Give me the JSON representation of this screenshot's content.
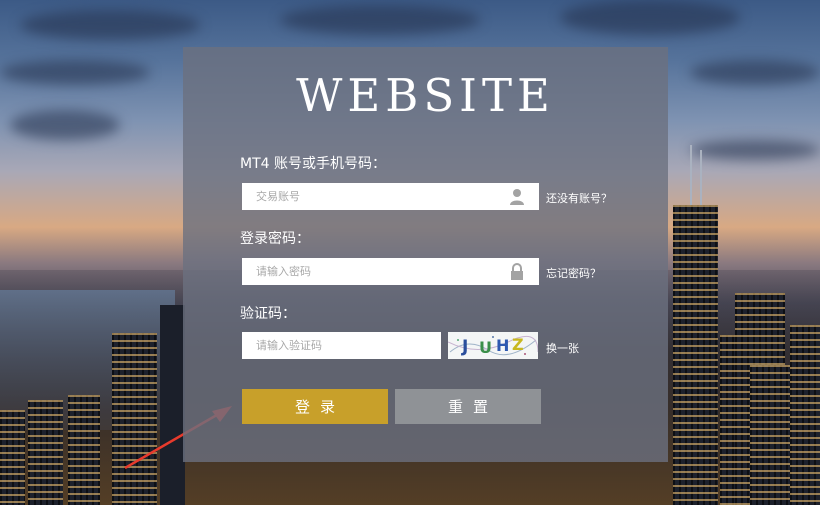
{
  "brand": {
    "title": "WEBSITE"
  },
  "account": {
    "label": "MT4 账号或手机号码：",
    "placeholder": "交易账号",
    "icon": "user-icon",
    "side_link": "还没有账号？"
  },
  "password": {
    "label": "登录密码：",
    "placeholder": "请输入密码",
    "icon": "lock-icon",
    "side_link": "忘记密码？"
  },
  "captcha": {
    "label": "验证码：",
    "placeholder": "请输入验证码",
    "image_text": "JUHZ",
    "refresh_link": "换一张"
  },
  "buttons": {
    "login": "登录",
    "reset": "重置",
    "login_color": "#c8a02a",
    "reset_color": "#8f9296"
  },
  "annotation": {
    "icon": "red-arrow-icon",
    "color": "#e83a2c"
  }
}
